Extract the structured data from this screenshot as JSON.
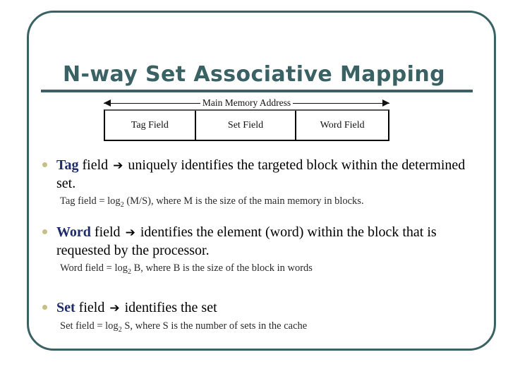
{
  "slide": {
    "title": "N-way Set Associative Mapping",
    "accent_color": "#3a6264",
    "keyword_color": "#1d2b6b",
    "bullet_color": "#c6bf8a",
    "background": "#ffffff"
  },
  "diagram": {
    "address_label": "Main Memory Address",
    "arrow_left": "◀",
    "arrow_right": "▶",
    "fields": [
      {
        "label": "Tag Field"
      },
      {
        "label": "Set Field"
      },
      {
        "label": "Word Field"
      }
    ]
  },
  "bullets": [
    {
      "keyword": "Tag",
      "arrow": "➔",
      "body": " field ",
      "text": "uniquely identifies the targeted block within the determined set.",
      "formula_prefix": "Tag field = log",
      "formula_base": "2",
      "formula_rest": " (M/S), where M is the size of the main memory in blocks."
    },
    {
      "keyword": "Word",
      "arrow": "➔",
      "body": " field ",
      "text": "identifies the element (word) within the block that is requested by the processor.",
      "formula_prefix": "Word field = log",
      "formula_base": "2",
      "formula_rest": " B, where B is the size of the block in words"
    },
    {
      "keyword": "Set",
      "arrow": "➔",
      "body": " field ",
      "text": "identifies the set",
      "formula_prefix": "Set field = log",
      "formula_base": "2",
      "formula_rest": " S, where S is the number of sets in the cache"
    }
  ]
}
